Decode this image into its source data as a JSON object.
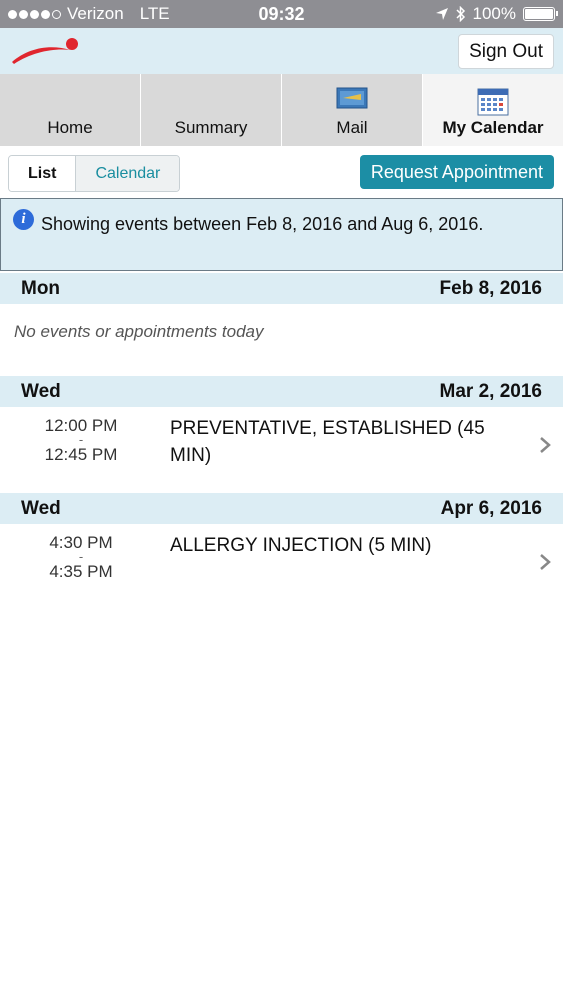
{
  "status_bar": {
    "carrier": "Verizon",
    "network": "LTE",
    "time": "09:32",
    "battery": "100%"
  },
  "header": {
    "logo_icon": "swoosh-figure-logo",
    "sign_out_label": "Sign Out"
  },
  "tabs": [
    {
      "label": "Home"
    },
    {
      "label": "Summary"
    },
    {
      "label": "Mail",
      "icon": "mail-icon"
    },
    {
      "label": "My Calendar",
      "icon": "calendar-icon",
      "active": true
    }
  ],
  "toolbar": {
    "list_label": "List",
    "calendar_label": "Calendar",
    "request_label": "Request Appointment"
  },
  "info": {
    "text": "Showing events between Feb 8, 2016 and Aug 6, 2016."
  },
  "days": [
    {
      "dow": "Mon",
      "date": "Feb 8, 2016",
      "empty_text": "No events or appointments today"
    },
    {
      "dow": "Wed",
      "date": "Mar 2, 2016",
      "event": {
        "start": "12:00 PM",
        "dash": "-",
        "end": "12:45 PM",
        "title": "PREVENTATIVE, ESTABLISHED (45 MIN)"
      }
    },
    {
      "dow": "Wed",
      "date": "Apr 6, 2016",
      "event": {
        "start": "4:30 PM",
        "dash": "-",
        "end": "4:35 PM",
        "title": "ALLERGY INJECTION (5 MIN)"
      }
    }
  ],
  "colors": {
    "status_bar": "#8e8e93",
    "header_bg": "#dcedf4",
    "accent": "#1c8ea5",
    "tab_bg": "#d9d9d9"
  }
}
